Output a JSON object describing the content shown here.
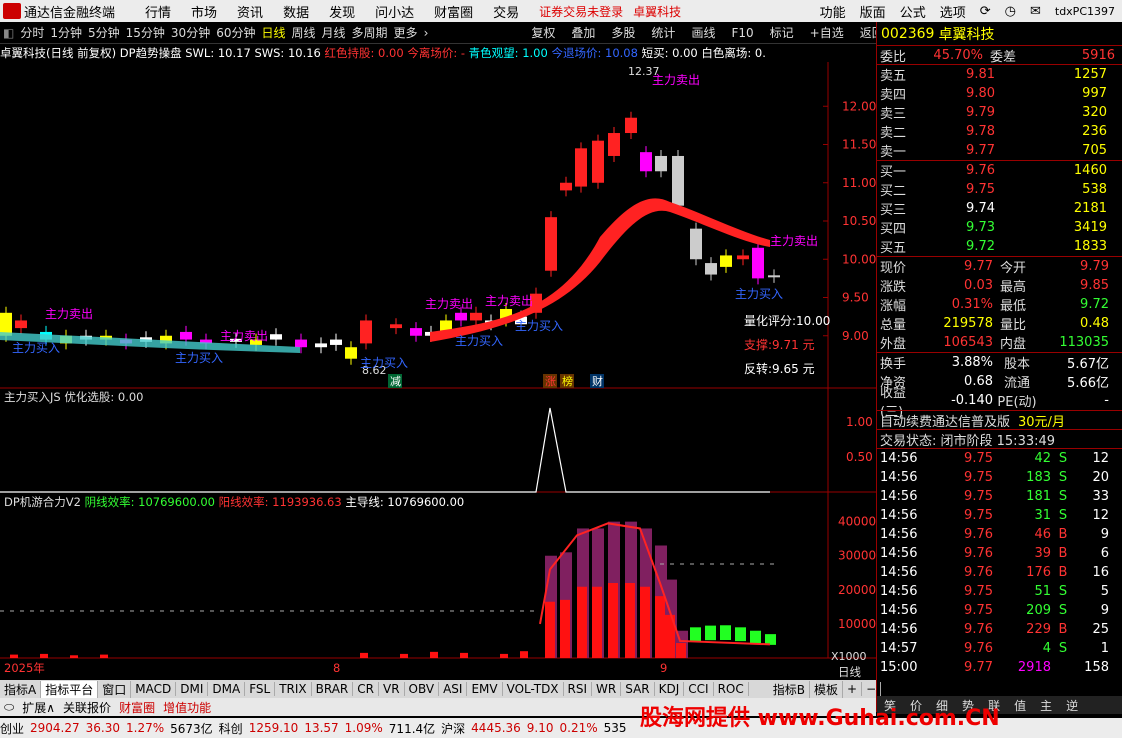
{
  "menubar": {
    "app_title": "通达信金融终端",
    "items": [
      "行情",
      "市场",
      "资讯",
      "数据",
      "发现",
      "问小达",
      "财富圈",
      "交易"
    ],
    "warning": "证券交易未登录",
    "warning_name": "卓翼科技",
    "right_items": [
      "功能",
      "版面",
      "公式",
      "选项"
    ],
    "account": "tdxPC1397"
  },
  "toolbar": {
    "periods": [
      "分时",
      "1分钟",
      "5分钟",
      "15分钟",
      "30分钟",
      "60分钟",
      "日线",
      "周线",
      "月线",
      "多周期",
      "更多"
    ],
    "selected": "日线",
    "actions": [
      "复权",
      "叠加",
      "多股",
      "统计",
      "画线",
      "F10",
      "标记",
      "+自选",
      "返回"
    ]
  },
  "chart_header": {
    "name": "卓翼科技(日线 前复权)",
    "indicator": "DP趋势操盘",
    "swl": "SWL: 10.17",
    "sws": "SWS: 10.16",
    "hold": "红色持股: 0.00",
    "exit": "今离场价: -",
    "watch": "青色观望: 1.00",
    "retreat": "今退场价: 10.08",
    "short": "短买: 0.00",
    "white": "白色离场: 0.",
    "mark_high": "12.37",
    "mark_low": "8.62",
    "lh_score": "量化评分:10.00",
    "support": "支撑:9.71 元",
    "reverse": "反转:9.65 元",
    "tags": [
      "减",
      "涨",
      "榜",
      "财"
    ],
    "labels_sell": "主力卖出",
    "labels_buy": "主力买入"
  },
  "panel2": {
    "title": "主力买入JS",
    "opt": "优化选股: 0.00"
  },
  "panel3": {
    "title": "DP机游合力V2",
    "yin": "阴线效率: 10769600.00",
    "yang": "阳线效率: 1193936.63",
    "main": "主导线: 10769600.00"
  },
  "xaxis": {
    "year": "2025年",
    "m8": "8",
    "m9": "9",
    "mult": "X1000",
    "period": "日线"
  },
  "chart_data": [
    {
      "type": "candlestick",
      "title": "卓翼科技(日线 前复权)",
      "y_ticks": [
        12.0,
        11.5,
        11.0,
        10.5,
        10.0,
        9.5,
        9.0
      ],
      "ylim": [
        8.5,
        12.5
      ],
      "high": 12.37,
      "low": 8.62
    },
    {
      "type": "line",
      "title": "主力买入JS",
      "y_ticks": [
        1.0,
        0.5
      ],
      "ylim": [
        0,
        1.2
      ]
    },
    {
      "type": "bar",
      "title": "DP机游合力V2",
      "y_ticks": [
        40000,
        30000,
        20000,
        10000
      ],
      "ylim": [
        0,
        44000
      ]
    }
  ],
  "quote": {
    "code": "002369",
    "name": "卓翼科技",
    "weibi_label": "委比",
    "weibi": "45.70%",
    "weicha_label": "委差",
    "weicha": "5916",
    "asks": [
      {
        "label": "卖五",
        "price": "9.81",
        "vol": "1257"
      },
      {
        "label": "卖四",
        "price": "9.80",
        "vol": "997"
      },
      {
        "label": "卖三",
        "price": "9.79",
        "vol": "320"
      },
      {
        "label": "卖二",
        "price": "9.78",
        "vol": "236"
      },
      {
        "label": "卖一",
        "price": "9.77",
        "vol": "705"
      }
    ],
    "bids": [
      {
        "label": "买一",
        "price": "9.76",
        "vol": "1460"
      },
      {
        "label": "买二",
        "price": "9.75",
        "vol": "538"
      },
      {
        "label": "买三",
        "price": "9.74",
        "vol": "2181"
      },
      {
        "label": "买四",
        "price": "9.73",
        "vol": "3419"
      },
      {
        "label": "买五",
        "price": "9.72",
        "vol": "1833"
      }
    ],
    "stats": [
      {
        "l1": "现价",
        "v1": "9.77",
        "l2": "今开",
        "v2": "9.79"
      },
      {
        "l1": "涨跌",
        "v1": "0.03",
        "l2": "最高",
        "v2": "9.85"
      },
      {
        "l1": "涨幅",
        "v1": "0.31%",
        "l2": "最低",
        "v2": "9.72"
      },
      {
        "l1": "总量",
        "v1": "219578",
        "l2": "量比",
        "v2": "0.48"
      },
      {
        "l1": "外盘",
        "v1": "106543",
        "l2": "内盘",
        "v2": "113035"
      }
    ],
    "stats2": [
      {
        "l1": "换手",
        "v1": "3.88%",
        "l2": "股本",
        "v2": "5.67亿"
      },
      {
        "l1": "净资",
        "v1": "0.68",
        "l2": "流通",
        "v2": "5.66亿"
      },
      {
        "l1": "收益(三)",
        "v1": "-0.140",
        "l2": "PE(动)",
        "v2": "-"
      }
    ],
    "promo": "自动续费通达信普及版",
    "promo_price": "30元/月",
    "trade_status": "交易状态: 闭市阶段 15:33:49",
    "ticks": [
      {
        "t": "14:56",
        "p": "9.75",
        "v": "42",
        "s": "S",
        "n": "12"
      },
      {
        "t": "14:56",
        "p": "9.75",
        "v": "183",
        "s": "S",
        "n": "20"
      },
      {
        "t": "14:56",
        "p": "9.75",
        "v": "181",
        "s": "S",
        "n": "33"
      },
      {
        "t": "14:56",
        "p": "9.75",
        "v": "31",
        "s": "S",
        "n": "12"
      },
      {
        "t": "14:56",
        "p": "9.76",
        "v": "46",
        "s": "B",
        "n": "9"
      },
      {
        "t": "14:56",
        "p": "9.76",
        "v": "39",
        "s": "B",
        "n": "6"
      },
      {
        "t": "14:56",
        "p": "9.76",
        "v": "176",
        "s": "B",
        "n": "16"
      },
      {
        "t": "14:56",
        "p": "9.75",
        "v": "51",
        "s": "S",
        "n": "5"
      },
      {
        "t": "14:56",
        "p": "9.75",
        "v": "209",
        "s": "S",
        "n": "9"
      },
      {
        "t": "14:56",
        "p": "9.76",
        "v": "229",
        "s": "B",
        "n": "25"
      },
      {
        "t": "14:57",
        "p": "9.76",
        "v": "4",
        "s": "S",
        "n": "1"
      },
      {
        "t": "15:00",
        "p": "9.77",
        "v": "2918",
        "s": "",
        "n": "158"
      }
    ],
    "bottom_tabs": [
      "笑",
      "价",
      "细",
      "势",
      "联",
      "值",
      "主",
      "逆"
    ]
  },
  "indicator_tabs": [
    "指标A",
    "指标平台",
    "窗口",
    "MACD",
    "DMI",
    "DMA",
    "FSL",
    "TRIX",
    "BRAR",
    "CR",
    "VR",
    "OBV",
    "ASI",
    "EMV",
    "VOL-TDX",
    "RSI",
    "WR",
    "SAR",
    "KDJ",
    "CCI",
    "ROC",
    "指标B",
    "模板",
    "+",
    "−"
  ],
  "bottom2": [
    "扩展∧",
    "关联报价",
    "财富圈",
    "增值功能"
  ],
  "status": [
    {
      "label": "创业",
      "v": "2904.27",
      "c": "36.30",
      "p": "1.27%",
      "a": "5673亿"
    },
    {
      "label": "科创",
      "v": "1259.10",
      "c": "13.57",
      "p": "1.09%",
      "a": "711.4亿"
    },
    {
      "label": "沪深",
      "v": "4445.36",
      "c": "9.10",
      "p": "0.21%",
      "a": "535"
    }
  ],
  "watermark": "股海网提供 www.Guhai.com.CN"
}
